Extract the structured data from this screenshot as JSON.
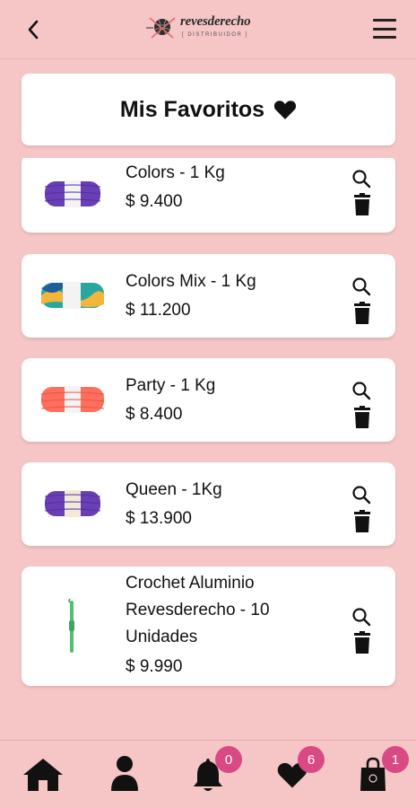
{
  "header": {
    "logo_text": "revesderecho",
    "logo_sub": "[ DISTRIBUIDOR ]"
  },
  "title": {
    "text": "Mis Favoritos"
  },
  "products": [
    {
      "name": "Colors - 1 Kg",
      "price": "$ 9.400",
      "thumb_color": "#6a3fb5"
    },
    {
      "name": "Colors Mix - 1 Kg",
      "price": "$ 11.200",
      "thumb_color": "multicolor"
    },
    {
      "name": "Party - 1 Kg",
      "price": "$ 8.400",
      "thumb_color": "#ff6f5e"
    },
    {
      "name": "Queen - 1Kg",
      "price": "$ 13.900",
      "thumb_color": "#6a3fb5"
    },
    {
      "name": "Crochet Aluminio Revesderecho - 10 Unidades",
      "price": "$ 9.990",
      "thumb_color": "#4fc06f"
    }
  ],
  "nav": {
    "items": [
      "home-icon",
      "user-icon",
      "bell-icon",
      "heart-icon",
      "shopping-bag-icon"
    ],
    "notifications_count": "0",
    "favorites_count": "6",
    "cart_count": "1"
  },
  "colors": {
    "background": "#f6c5c6",
    "badge": "#d94a85",
    "card": "#ffffff"
  }
}
